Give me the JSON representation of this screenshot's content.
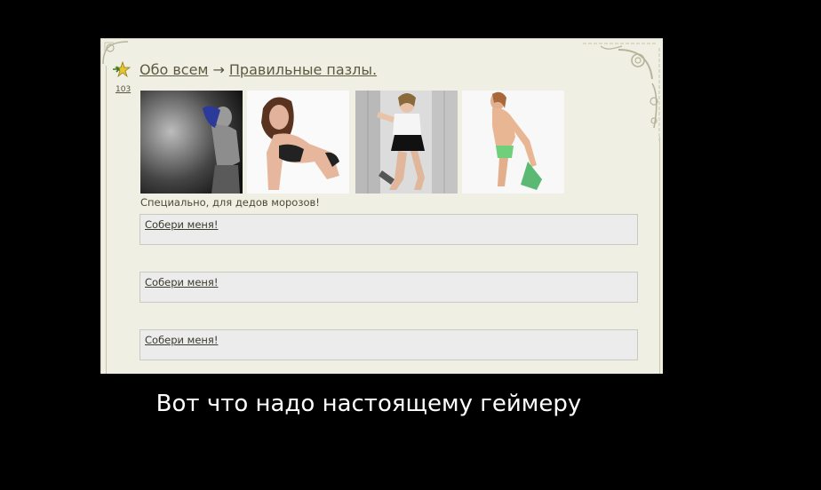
{
  "post": {
    "count": "103",
    "breadcrumb": {
      "section": "Обо всем",
      "arrow": "→",
      "title": "Правильные пазлы."
    },
    "thumbnails": [
      {
        "icon": "photo-woman-dark-background"
      },
      {
        "icon": "photo-woman-lingerie-kneeling"
      },
      {
        "icon": "photo-woman-school-uniform-lockers"
      },
      {
        "icon": "photo-woman-green-bikini"
      }
    ],
    "caption": "Специально, для дедов морозов!",
    "puzzles": [
      {
        "label": "Собери меня!"
      },
      {
        "label": "Собери меня!"
      },
      {
        "label": "Собери меня!"
      }
    ]
  },
  "motto": "Вот что надо настоящему геймеру",
  "colors": {
    "background": "#000000",
    "frame": "#f0efe3",
    "puzzle_box": "#ececec",
    "link": "#5b5a40"
  }
}
